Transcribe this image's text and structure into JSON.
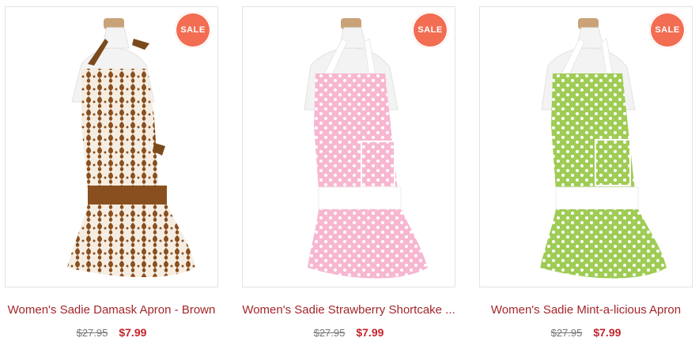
{
  "products": [
    {
      "badge": "SALE",
      "title": "Women's Sadie Damask Apron - Brown",
      "old_price": "$27.95",
      "new_price": "$7.99",
      "colors": {
        "fabric": "#f5ede2",
        "pattern": "#8a4f1e",
        "accent": "#7b4a1c"
      }
    },
    {
      "badge": "SALE",
      "title": "Women's Sadie Strawberry Shortcake ...",
      "old_price": "$27.95",
      "new_price": "$7.99",
      "colors": {
        "fabric": "#f7b7d1",
        "pattern": "#ffffff",
        "accent": "#ffffff"
      }
    },
    {
      "badge": "SALE",
      "title": "Women's Sadie Mint-a-licious Apron",
      "old_price": "$27.95",
      "new_price": "$7.99",
      "colors": {
        "fabric": "#9fcc55",
        "pattern": "#ffffff",
        "accent": "#ffffff"
      }
    }
  ]
}
